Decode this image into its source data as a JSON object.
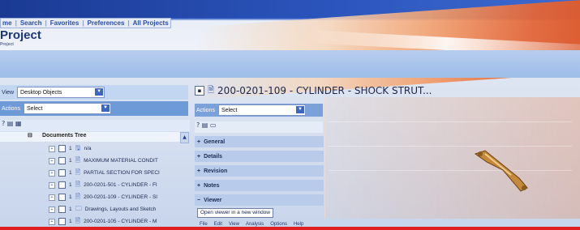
{
  "menu": {
    "items": [
      "me",
      "Search",
      "Favorites",
      "Preferences",
      "All Projects"
    ]
  },
  "project": {
    "title": "Project",
    "subtitle": "Project"
  },
  "left_panel": {
    "view_label": "View",
    "view_value": "Desktop Objects",
    "actions_label": "Actions",
    "actions_value": "Select",
    "tools": "? ▤ ▦",
    "tree_header": "Documents Tree",
    "tree_items": [
      {
        "count": "1",
        "icon": "disk-icon",
        "label": "n/a"
      },
      {
        "count": "1",
        "icon": "document-icon",
        "label": "MAXIMUM MATERIAL CONDIT"
      },
      {
        "count": "1",
        "icon": "document-icon",
        "label": "PARTIAL SECTION FOR SPECI"
      },
      {
        "count": "1",
        "icon": "document-icon",
        "label": "200-0201-501 - CYLINDER - FI"
      },
      {
        "count": "1",
        "icon": "document-icon",
        "label": "200-0201-109 - CYLINDER - SI"
      },
      {
        "count": "1",
        "icon": "folder-icon",
        "label": "Drawings, Layouts and Sketch"
      },
      {
        "count": "1",
        "icon": "document-icon",
        "label": "200-0201-105 - CYLINDER - M"
      }
    ]
  },
  "right_panel": {
    "title": "200-0201-109 - CYLINDER - SHOCK STRUT...",
    "actions_label": "Actions",
    "actions_value": "Select",
    "tools": "? ▤ ▭",
    "sections": [
      "General",
      "Details",
      "Revision",
      "Notes",
      "Viewer"
    ],
    "viewer_link": "Open viewer in a new window",
    "viewer_menu": [
      "File",
      "Edit",
      "View",
      "Analysis",
      "Options",
      "Help"
    ]
  },
  "colors": {
    "accent_blue": "#2b54bb",
    "orange": "#e2663a",
    "red_line": "#e02020"
  }
}
